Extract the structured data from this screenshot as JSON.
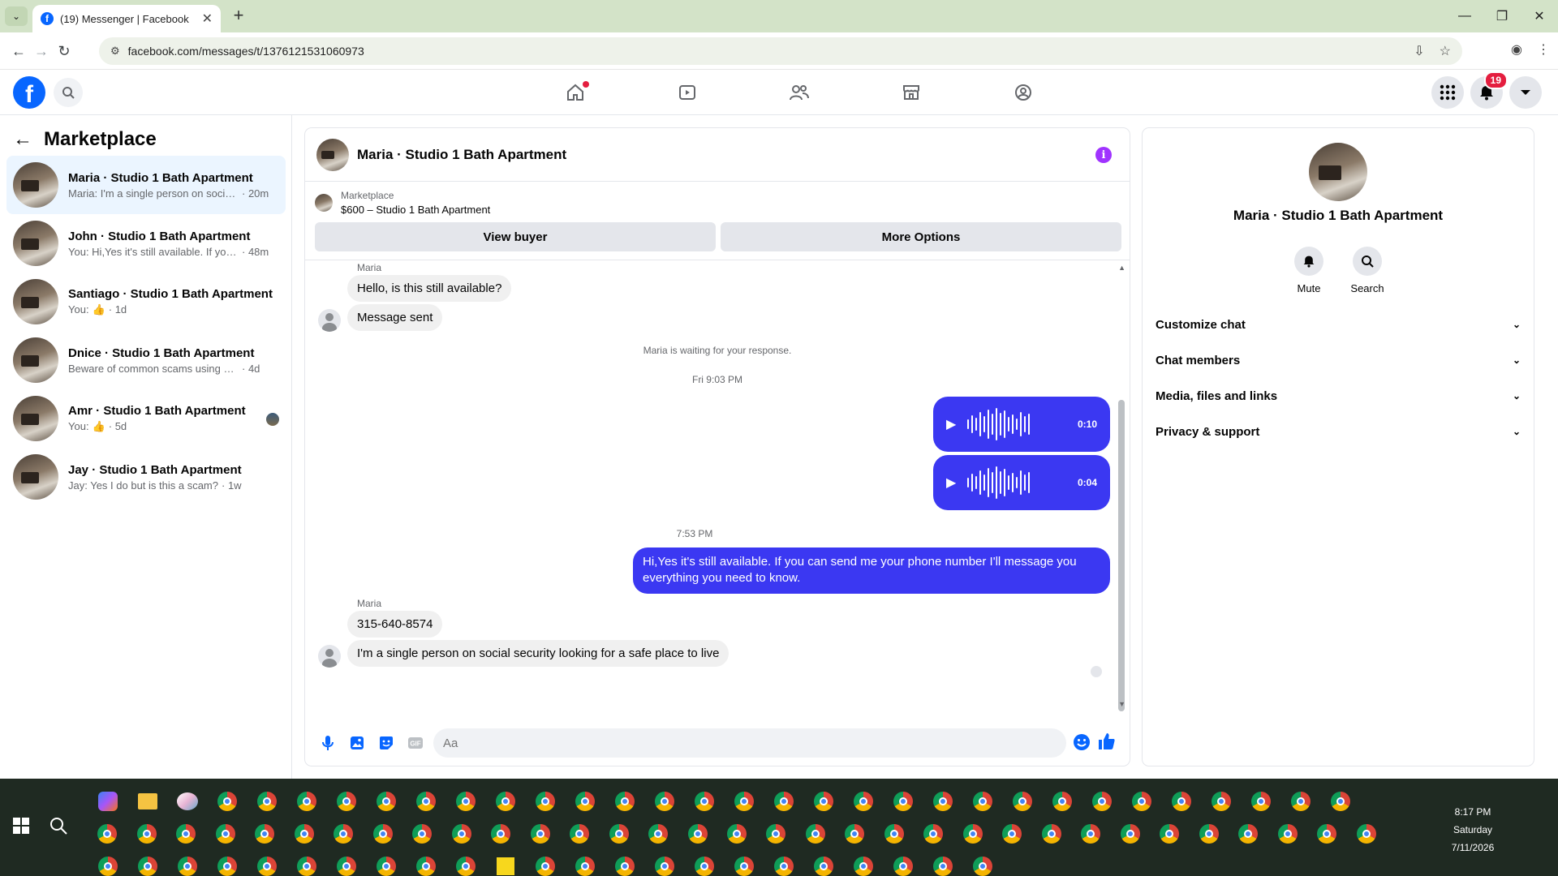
{
  "browser": {
    "tab_title": "(19) Messenger | Facebook",
    "url": "facebook.com/messages/t/1376121531060973"
  },
  "fb": {
    "notifications_count": "19"
  },
  "sidebar": {
    "title": "Marketplace",
    "conversations": [
      {
        "name": "Maria · Studio 1 Bath Apartment",
        "preview": "Maria: I'm a single person on social ...",
        "time": "· 20m",
        "active": true
      },
      {
        "name": "John · Studio 1 Bath Apartment",
        "preview": "You: Hi,Yes it's still available. If you c...",
        "time": "· 48m"
      },
      {
        "name": "Santiago · Studio 1 Bath Apartment",
        "preview": "You:",
        "time": "· 1d",
        "thumb": true
      },
      {
        "name": "Dnice · Studio 1 Bath Apartment",
        "preview": "Beware of common scams using pay...",
        "time": "· 4d"
      },
      {
        "name": "Amr · Studio 1 Bath Apartment",
        "preview": "You:",
        "time": "· 5d",
        "thumb": true
      },
      {
        "name": "Jay · Studio 1 Bath Apartment",
        "preview": "Jay: Yes I do but is this a scam?",
        "time": "· 1w"
      }
    ]
  },
  "chat": {
    "title": "Maria · Studio 1 Bath Apartment",
    "listing_label": "Marketplace",
    "listing_value": "$600 – Studio 1 Bath Apartment",
    "view_buyer": "View buyer",
    "more_options": "More Options",
    "sender1": "Maria",
    "msg1": "Hello, is this still available?",
    "msg2": "Message sent",
    "waiting": "Maria is waiting for your response.",
    "time1": "Fri 9:03 PM",
    "voice1": "0:10",
    "voice2": "0:04",
    "time2": "7:53 PM",
    "out_msg": "Hi,Yes it's still available. If you can send me your phone number I'll message you everything you need to know.",
    "sender2": "Maria",
    "msg3": "315-640-8574",
    "msg4": "I'm a single person on social security looking for a safe place to live",
    "composer_placeholder": "Aa"
  },
  "info": {
    "name": "Maria · Studio 1 Bath Apartment",
    "mute": "Mute",
    "search": "Search",
    "sections": [
      "Customize chat",
      "Chat members",
      "Media, files and links",
      "Privacy & support"
    ]
  },
  "taskbar": {
    "time": "8:17 PM",
    "day": "Saturday",
    "date": "7/11/2026"
  }
}
